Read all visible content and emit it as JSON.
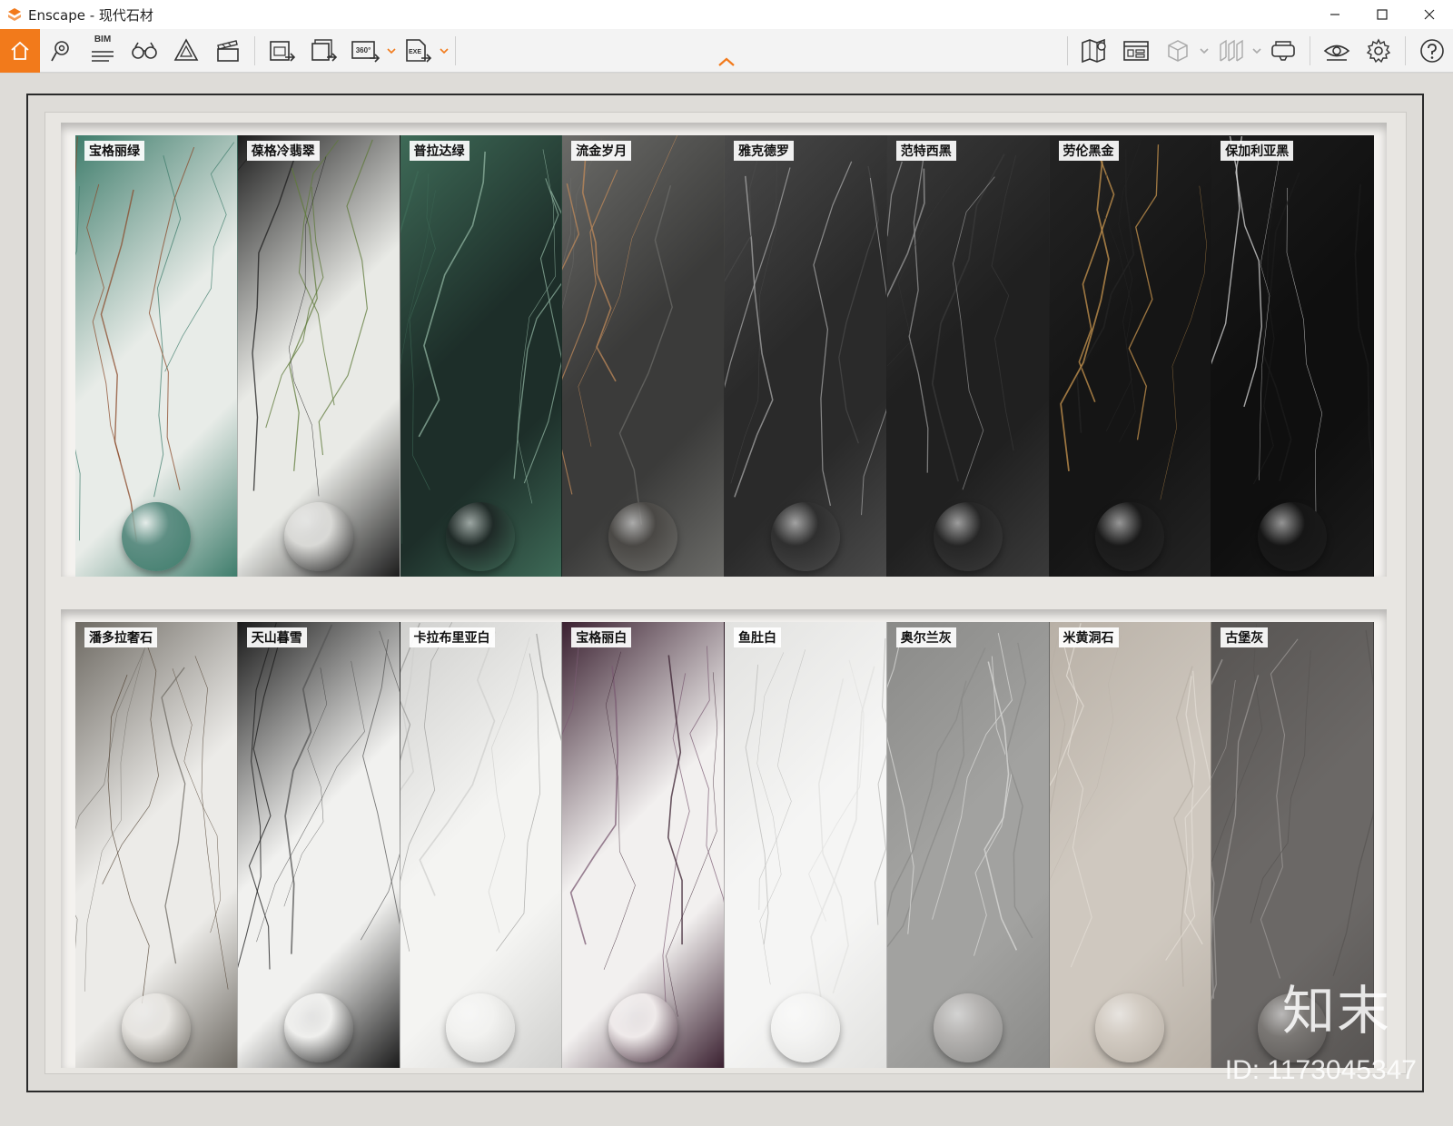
{
  "window": {
    "title": "Enscape - 现代石材",
    "colors": {
      "accent": "#f27a1b"
    }
  },
  "toolbar": {
    "home": "home-icon",
    "bim_label": "BIM",
    "left_tools": [
      "locate-icon",
      "bim-icon",
      "binoculars-icon",
      "asset-library-icon",
      "video-editor-icon",
      "render-image-icon",
      "batch-render-icon",
      "panorama-360-icon",
      "export-exe-icon"
    ],
    "badge_360": "360°",
    "badge_exe": "EXE",
    "right_tools": [
      "map-icon",
      "mini-map-icon",
      "view-box-icon",
      "section-icon",
      "vr-headset-icon",
      "visual-settings-icon",
      "settings-gear-icon",
      "help-icon"
    ]
  },
  "shelves": {
    "top": [
      {
        "label": "宝格丽绿",
        "base": "#e8ece8",
        "accent": "#3f7d6c",
        "vein": "#8b4a2a",
        "sphere": "#5f8f84"
      },
      {
        "label": "葆格冷翡翠",
        "base": "#e9eae6",
        "accent": "#1c1c1c",
        "vein": "#5f7a3a",
        "sphere": "#d9d9d6"
      },
      {
        "label": "普拉达绿",
        "base": "#1d2e29",
        "accent": "#3e6a57",
        "vein": "#8fb3a0",
        "sphere": "#1f2a27"
      },
      {
        "label": "流金岁月",
        "base": "#3b3b3a",
        "accent": "#6b6b68",
        "vein": "#c08a5a",
        "sphere": "#4a4845"
      },
      {
        "label": "雅克德罗",
        "base": "#2a2a2a",
        "accent": "#4a4a4a",
        "vein": "#a8a8a8",
        "sphere": "#2f2f2f"
      },
      {
        "label": "范特西黑",
        "base": "#202020",
        "accent": "#3a3a3a",
        "vein": "#9a9a9a",
        "sphere": "#262626"
      },
      {
        "label": "劳伦黑金",
        "base": "#151515",
        "accent": "#242424",
        "vein": "#c9964f",
        "sphere": "#1a1a1a"
      },
      {
        "label": "保加利亚黑",
        "base": "#0f0f0f",
        "accent": "#1c1c1c",
        "vein": "#d8d8d8",
        "sphere": "#161616"
      }
    ],
    "bottom": [
      {
        "label": "潘多拉奢石",
        "base": "#ecebe8",
        "accent": "#6e6a63",
        "vein": "#4a3a2a",
        "sphere": "#e6e4e0"
      },
      {
        "label": "天山暮雪",
        "base": "#f1f1ef",
        "accent": "#1a1a1a",
        "vein": "#555555",
        "sphere": "#efefed"
      },
      {
        "label": "卡拉布里亚白",
        "base": "#f4f4f2",
        "accent": "#d0d0ce",
        "vein": "#9a9a98",
        "sphere": "#f2f2f0"
      },
      {
        "label": "宝格丽白",
        "base": "#f2f0ef",
        "accent": "#3a2030",
        "vein": "#7a5a72",
        "sphere": "#efeaea"
      },
      {
        "label": "鱼肚白",
        "base": "#f5f5f4",
        "accent": "#e2e2e0",
        "vein": "#b8b8b6",
        "sphere": "#f4f4f3"
      },
      {
        "label": "奥尔兰灰",
        "base": "#a2a2a0",
        "accent": "#8a8a88",
        "vein": "#dadad8",
        "sphere": "#b5b3b1"
      },
      {
        "label": "米黄洞石",
        "base": "#cfc8bf",
        "accent": "#b8b0a6",
        "vein": "#e4ded6",
        "sphere": "#d2cbc2"
      },
      {
        "label": "古堡灰",
        "base": "#6b6866",
        "accent": "#575452",
        "vein": "#9c9896",
        "sphere": "#7a7774"
      }
    ]
  },
  "watermark": {
    "logo_text": "知末",
    "id_text": "ID: 1173045347"
  }
}
